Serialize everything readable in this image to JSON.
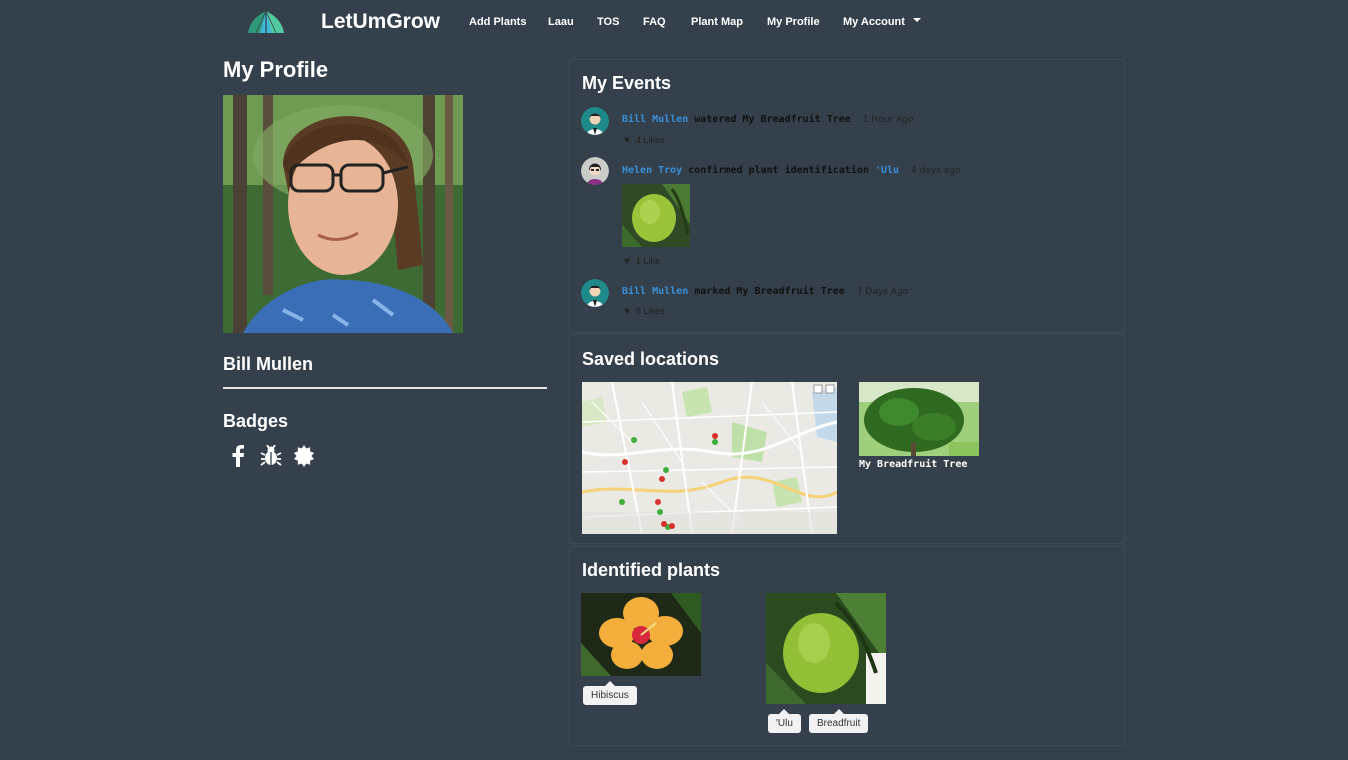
{
  "nav": {
    "brand": "LetUmGrow",
    "items": [
      {
        "label": "Add Plants"
      },
      {
        "label": "Laau"
      },
      {
        "label": "TOS"
      },
      {
        "label": "FAQ"
      },
      {
        "label": "Plant Map"
      },
      {
        "label": "My Profile"
      },
      {
        "label": "My Account"
      }
    ]
  },
  "profile": {
    "title": "My Profile",
    "name": "Bill Mullen",
    "badges_title": "Badges",
    "badges": [
      "facebook-icon",
      "bug-icon",
      "gear-badge-icon"
    ]
  },
  "events": {
    "title": "My Events",
    "items": [
      {
        "user": "Bill Mullen",
        "action": "watered My Breadfruit Tree",
        "link": "",
        "time": "1 Hour Ago",
        "likes": "4 Likes"
      },
      {
        "user": "Helen Troy",
        "action": "confirmed plant identification",
        "link": "'Ulu",
        "time": "4 days ago",
        "likes": "1 Like"
      },
      {
        "user": "Bill Mullen",
        "action": "marked My Breadfruit Tree",
        "link": "",
        "time": "7 Days Ago",
        "likes": "8 Likes"
      }
    ]
  },
  "saved": {
    "title": "Saved locations",
    "location_label": "My Breadfruit Tree"
  },
  "plants": {
    "title": "Identified plants",
    "items": [
      {
        "tags": [
          "Hibiscus"
        ]
      },
      {
        "tags": [
          "'Ulu",
          "Breadfruit"
        ]
      }
    ]
  },
  "colors": {
    "background": "#34414c",
    "link": "#3b8fd8",
    "accent": "#38b48a"
  }
}
